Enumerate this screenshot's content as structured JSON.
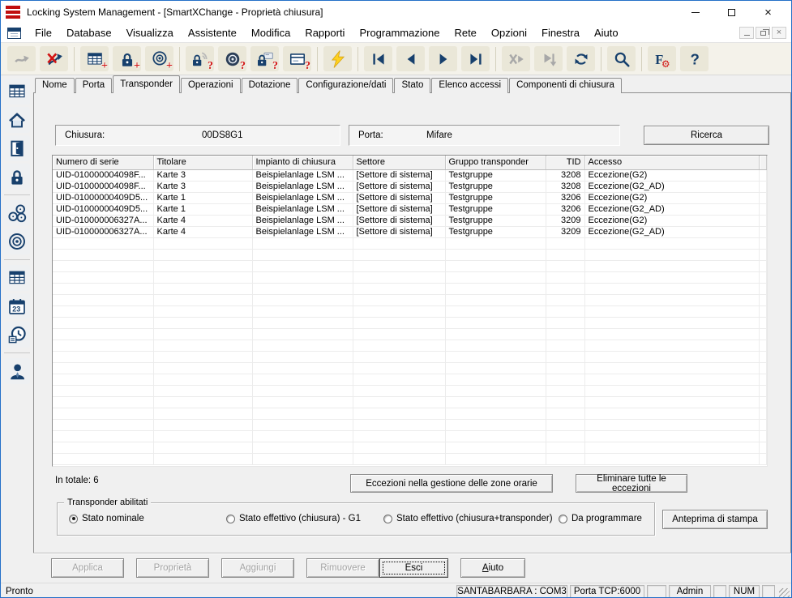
{
  "window": {
    "title": "Locking System Management - [SmartXChange - Proprietà chiusura]"
  },
  "menu": {
    "items": [
      "File",
      "Database",
      "Visualizza",
      "Assistente",
      "Modifica",
      "Rapporti",
      "Programmazione",
      "Rete",
      "Opzioni",
      "Finestra",
      "Aiuto"
    ]
  },
  "toolbar": {
    "groups": [
      [
        {
          "icon": "connect-icon",
          "disabled": true
        },
        {
          "icon": "disconnect-icon"
        }
      ],
      [
        {
          "icon": "new-locking-plan-icon",
          "badge": "+"
        },
        {
          "icon": "new-lock-icon",
          "badge": "+"
        },
        {
          "icon": "new-transponder-icon",
          "badge": "+"
        }
      ],
      [
        {
          "icon": "read-lock-icon",
          "badge": "?"
        },
        {
          "icon": "read-transponder-icon",
          "badge": "?"
        },
        {
          "icon": "read-mifare-lock-icon",
          "badge": "?"
        },
        {
          "icon": "read-card-icon",
          "badge": "?"
        }
      ],
      [
        {
          "icon": "program-icon"
        }
      ],
      [
        {
          "icon": "first-record-icon"
        },
        {
          "icon": "previous-record-icon"
        },
        {
          "icon": "next-record-icon"
        },
        {
          "icon": "last-record-icon"
        }
      ],
      [
        {
          "icon": "cancel-record-icon",
          "disabled": true
        },
        {
          "icon": "skip-record-icon",
          "disabled": true
        },
        {
          "icon": "refresh-icon"
        }
      ],
      [
        {
          "icon": "search-icon"
        }
      ],
      [
        {
          "icon": "filter-settings-icon"
        },
        {
          "icon": "help-icon"
        }
      ]
    ]
  },
  "sidebar": {
    "groups": [
      [
        "locking-plan-icon",
        "home-icon",
        "door-icon",
        "lock-icon"
      ],
      [
        "transponder-group-icon",
        "transponder-icon"
      ],
      [
        "matrix-icon",
        "calendar-icon",
        "timezone-icon"
      ],
      [
        "user-icon"
      ]
    ],
    "calendar_text": "23"
  },
  "tabs": {
    "items": [
      "Nome",
      "Porta",
      "Transponder",
      "Operazioni",
      "Dotazione",
      "Configurazione/dati",
      "Stato",
      "Elenco accessi",
      "Componenti di chiusura"
    ],
    "active_index": 2
  },
  "fields": {
    "chiusura_label": "Chiusura:",
    "chiusura_value": "00DS8G1",
    "porta_label": "Porta:",
    "porta_value": "Mifare",
    "ricerca_button": "Ricerca"
  },
  "table": {
    "columns": [
      "Numero di serie",
      "Titolare",
      "Impianto di chiusura",
      "Settore",
      "Gruppo transponder",
      "TID",
      "Accesso",
      ""
    ],
    "rows": [
      [
        "UID-010000004098F...",
        "Karte 3",
        "Beispielanlage LSM ...",
        "[Settore di sistema]",
        "Testgruppe",
        "3208",
        "Eccezione(G2)",
        ""
      ],
      [
        "UID-010000004098F...",
        "Karte 3",
        "Beispielanlage LSM ...",
        "[Settore di sistema]",
        "Testgruppe",
        "3208",
        "Eccezione(G2_AD)",
        ""
      ],
      [
        "UID-01000000409D5...",
        "Karte 1",
        "Beispielanlage LSM ...",
        "[Settore di sistema]",
        "Testgruppe",
        "3206",
        "Eccezione(G2)",
        ""
      ],
      [
        "UID-01000000409D5...",
        "Karte 1",
        "Beispielanlage LSM ...",
        "[Settore di sistema]",
        "Testgruppe",
        "3206",
        "Eccezione(G2_AD)",
        ""
      ],
      [
        "UID-010000006327A...",
        "Karte 4",
        "Beispielanlage LSM ...",
        "[Settore di sistema]",
        "Testgruppe",
        "3209",
        "Eccezione(G2)",
        ""
      ],
      [
        "UID-010000006327A...",
        "Karte 4",
        "Beispielanlage LSM ...",
        "[Settore di sistema]",
        "Testgruppe",
        "3209",
        "Eccezione(G2_AD)",
        ""
      ]
    ],
    "total_label": "In totale: 6"
  },
  "actions": {
    "eccezioni_button": "Eccezioni nella gestione delle zone orarie",
    "eliminare_button": "Eliminare tutte le eccezioni",
    "anteprima_button": "Anteprima di stampa"
  },
  "enabled_transponders": {
    "title": "Transponder abilitati",
    "options": [
      {
        "label": "Stato nominale",
        "selected": true
      },
      {
        "label": "Stato effettivo (chiusura) - G1",
        "selected": false
      },
      {
        "label": "Stato effettivo (chiusura+transponder)",
        "selected": false
      },
      {
        "label": "Da programmare",
        "selected": false
      }
    ]
  },
  "bottom_buttons": [
    {
      "label": "Applica",
      "disabled": true
    },
    {
      "label": "Proprietà",
      "disabled": true
    },
    {
      "label": "Aggiungi",
      "disabled": true
    },
    {
      "label": "Rimuovere",
      "disabled": true
    },
    {
      "label": "Esci",
      "focused": true
    },
    {
      "label": "Aiuto",
      "underline": true
    }
  ],
  "statusbar": {
    "ready": "Pronto",
    "cells": [
      "SANTABARBARA : COM3",
      "Porta TCP:6000",
      "",
      "Admin",
      "",
      "NUM",
      ""
    ]
  },
  "colors": {
    "accent_blue": "#2470c8",
    "icon_navy": "#17406d",
    "badge_red": "#d11414",
    "lightning_yellow": "#ffd21e",
    "toolbar_bg": "#f4f2ea",
    "toolbar_button_beige": "#eae7d8",
    "content_gray": "#f0f0f0",
    "grid_line": "#ececec",
    "disabled_text": "#a3a3a3"
  }
}
